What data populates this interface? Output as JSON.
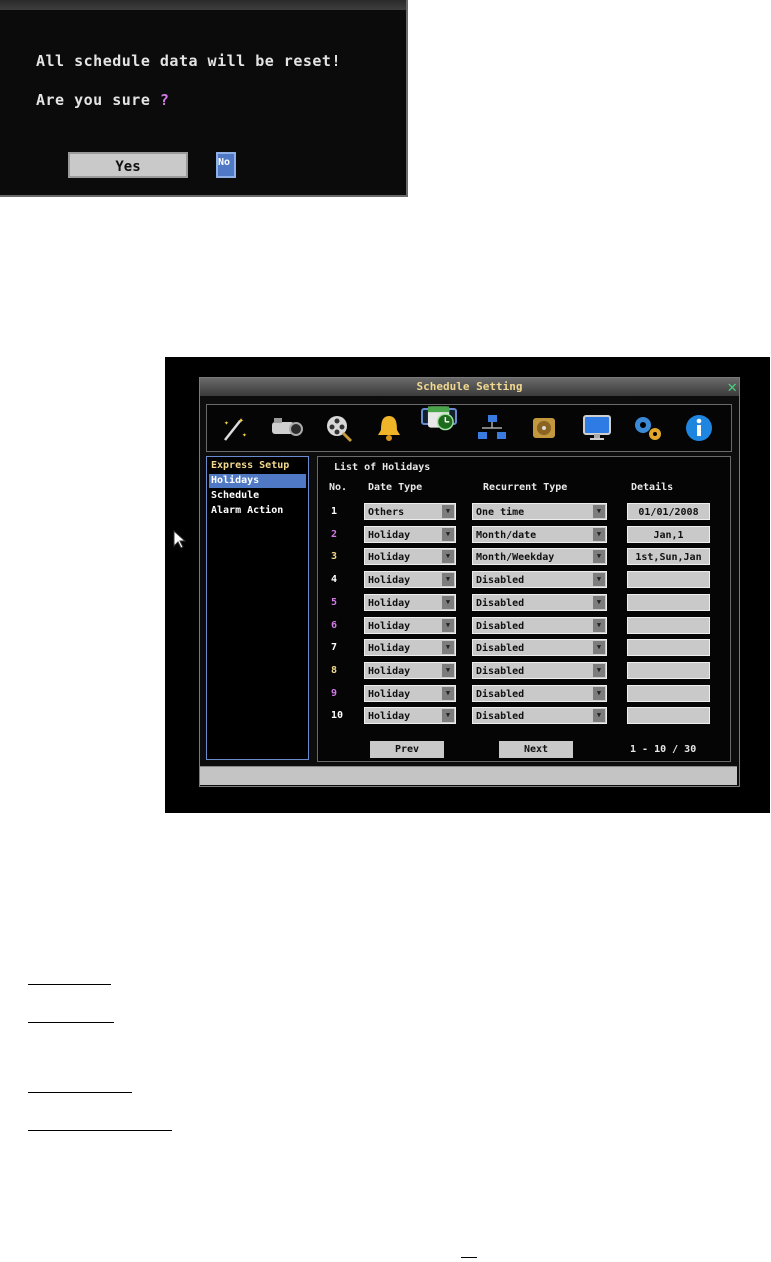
{
  "dialog": {
    "message": "All schedule data will be reset!",
    "question": "Are you sure",
    "question_mark": "?",
    "yes_label": "Yes",
    "no_label": "No"
  },
  "window": {
    "title": "Schedule Setting",
    "close_icon": "close-x-icon"
  },
  "toolbar_icons": [
    "magic-wand-icon",
    "camera-icon",
    "film-reel-icon",
    "bell-icon",
    "schedule-clock-icon",
    "network-icon",
    "hard-disk-icon",
    "monitor-icon",
    "gears-icon",
    "info-icon"
  ],
  "sidebar": {
    "items": [
      {
        "label": "Express Setup"
      },
      {
        "label": "Holidays"
      },
      {
        "label": "Schedule"
      },
      {
        "label": "Alarm Action"
      }
    ]
  },
  "panel": {
    "title": "List of Holidays",
    "headers": {
      "no": "No.",
      "date_type": "Date Type",
      "recurrent_type": "Recurrent Type",
      "details": "Details"
    },
    "rows": [
      {
        "no": "1",
        "date_type": "Others",
        "recurrent": "One time",
        "details": "01/01/2008"
      },
      {
        "no": "2",
        "date_type": "Holiday",
        "recurrent": "Month/date",
        "details": "Jan,1"
      },
      {
        "no": "3",
        "date_type": "Holiday",
        "recurrent": "Month/Weekday",
        "details": "1st,Sun,Jan"
      },
      {
        "no": "4",
        "date_type": "Holiday",
        "recurrent": "Disabled",
        "details": ""
      },
      {
        "no": "5",
        "date_type": "Holiday",
        "recurrent": "Disabled",
        "details": ""
      },
      {
        "no": "6",
        "date_type": "Holiday",
        "recurrent": "Disabled",
        "details": ""
      },
      {
        "no": "7",
        "date_type": "Holiday",
        "recurrent": "Disabled",
        "details": ""
      },
      {
        "no": "8",
        "date_type": "Holiday",
        "recurrent": "Disabled",
        "details": ""
      },
      {
        "no": "9",
        "date_type": "Holiday",
        "recurrent": "Disabled",
        "details": ""
      },
      {
        "no": "10",
        "date_type": "Holiday",
        "recurrent": "Disabled",
        "details": ""
      }
    ],
    "prev_label": "Prev",
    "next_label": "Next",
    "pager": "1 - 10 / 30"
  },
  "colors": {
    "accent_blue": "#4f79c4",
    "number_white": "#ffffff",
    "number_purple": "#d27be8",
    "number_yellow": "#f3d98e"
  }
}
